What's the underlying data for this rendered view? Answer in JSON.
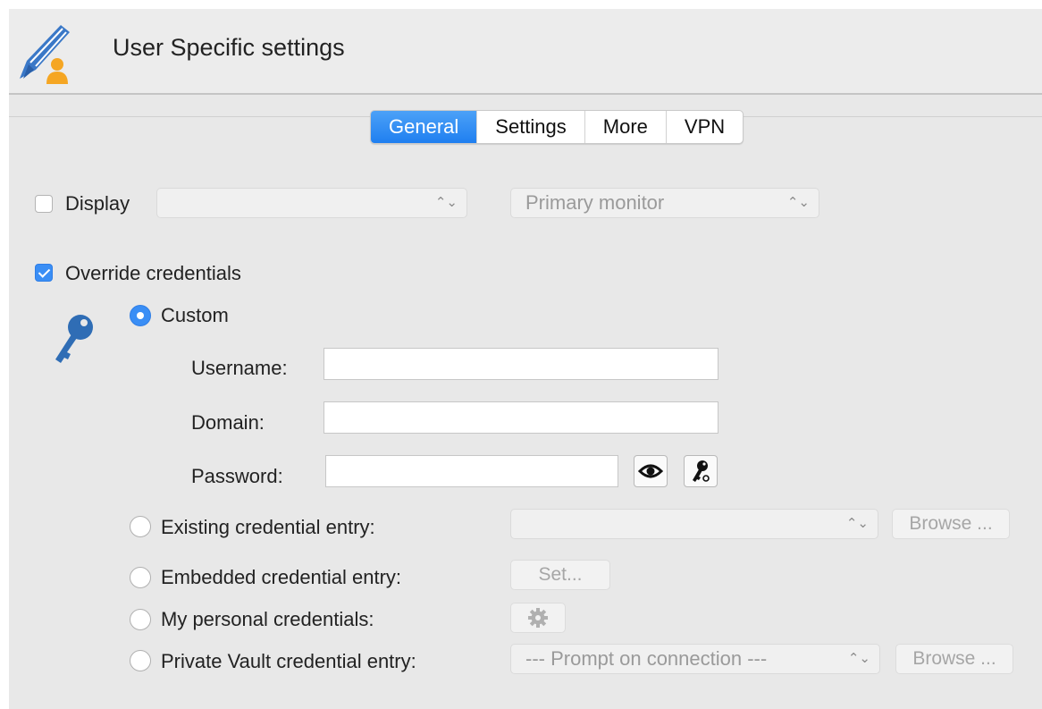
{
  "window": {
    "title": "User Specific settings",
    "app_icon": "pencil-user-icon"
  },
  "tabs": [
    {
      "label": "General",
      "active": true
    },
    {
      "label": "Settings",
      "active": false
    },
    {
      "label": "More",
      "active": false
    },
    {
      "label": "VPN",
      "active": false
    }
  ],
  "display": {
    "label": "Display",
    "checked": false,
    "select1_value": "",
    "select2_value": "Primary monitor"
  },
  "override": {
    "label": "Override credentials",
    "checked": true
  },
  "custom": {
    "label": "Custom",
    "selected": true,
    "username_label": "Username:",
    "username_value": "",
    "domain_label": "Domain:",
    "domain_value": "",
    "password_label": "Password:",
    "password_value": ""
  },
  "existing": {
    "label": "Existing credential entry:",
    "select_value": "",
    "browse_label": "Browse ..."
  },
  "embedded": {
    "label": "Embedded credential entry:",
    "set_label": "Set..."
  },
  "personal": {
    "label": "My personal credentials:"
  },
  "private_vault": {
    "label": "Private Vault credential entry:",
    "select_value": "--- Prompt on connection ---",
    "browse_label": "Browse ..."
  },
  "colors": {
    "accent": "#3a8ef5",
    "key_icon": "#2f6db5",
    "user_icon": "#f5a623"
  }
}
